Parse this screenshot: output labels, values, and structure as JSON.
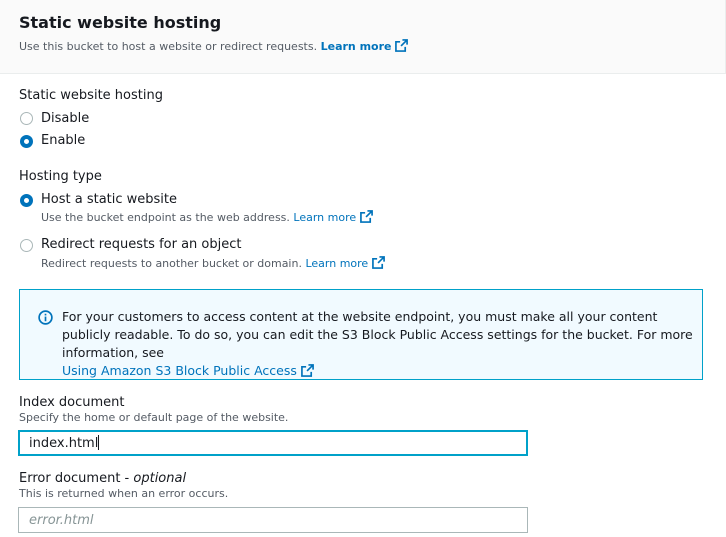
{
  "header": {
    "title": "Static website hosting",
    "description": "Use this bucket to host a website or redirect requests.",
    "learn_more": "Learn more"
  },
  "hosting": {
    "label": "Static website hosting",
    "options": [
      {
        "label": "Disable",
        "checked": false
      },
      {
        "label": "Enable",
        "checked": true
      }
    ]
  },
  "hosting_type": {
    "label": "Hosting type",
    "options": [
      {
        "label": "Host a static website",
        "description": "Use the bucket endpoint as the web address.",
        "learn_more": "Learn more",
        "checked": true
      },
      {
        "label": "Redirect requests for an object",
        "description": "Redirect requests to another bucket or domain.",
        "learn_more": "Learn more",
        "checked": false
      }
    ]
  },
  "info": {
    "text": "For your customers to access content at the website endpoint, you must make all your content publicly readable. To do so, you can edit the S3 Block Public Access settings for the bucket. For more information, see",
    "link": "Using Amazon S3 Block Public Access"
  },
  "index_document": {
    "label": "Index document",
    "description": "Specify the home or default page of the website.",
    "value": "index.html"
  },
  "error_document": {
    "label": "Error document",
    "optional": "optional",
    "separator": " - ",
    "description": "This is returned when an error occurs.",
    "placeholder": "error.html"
  },
  "colors": {
    "accent": "#0073bb",
    "info_border": "#00a1c9",
    "info_bg": "#f1faff"
  },
  "icons": [
    "external-link-icon",
    "info-icon"
  ]
}
